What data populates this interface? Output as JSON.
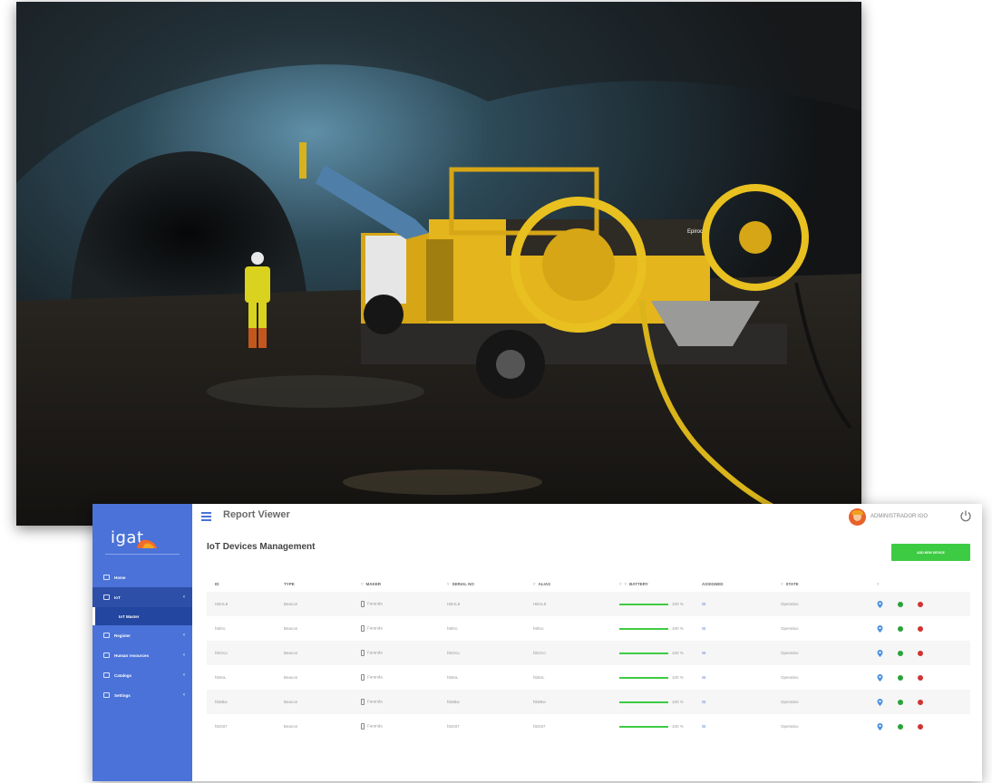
{
  "photo": {
    "alt_icon": "mine-photo",
    "brand_badge": "Epiroc"
  },
  "sidebar": {
    "logo_text": "igat",
    "items": [
      {
        "label": "Home",
        "icon": "home-icon"
      },
      {
        "label": "IoT",
        "icon": "iot-icon"
      },
      {
        "label": "IoT Master",
        "icon": ""
      },
      {
        "label": "Register",
        "icon": "register-icon"
      },
      {
        "label": "Human resources",
        "icon": "people-icon"
      },
      {
        "label": "Catalogs",
        "icon": "catalog-icon"
      },
      {
        "label": "Settings",
        "icon": "gear-icon"
      }
    ]
  },
  "header": {
    "title": "Report Viewer",
    "subtitle": "",
    "user": "ADMINISTRADOR IGO",
    "logout_icon": "power-icon"
  },
  "page": {
    "title": "IoT Devices Management",
    "add_button": "ADD NEW DEVICE"
  },
  "table": {
    "columns": [
      "ID",
      "TYPE",
      "MAKER",
      "SERIAL NO",
      "ALIAS",
      "BATTERY",
      "ASSIGNED",
      "STATE"
    ],
    "rows": [
      {
        "id": "HBAL8",
        "type": "Beacon",
        "maker": "Faranda",
        "serial": "HBAL8",
        "alias": "HBAL8",
        "battery": 100,
        "battery_label": "100 %",
        "assigned": "SI",
        "state": "Operativo"
      },
      {
        "id": "h6hro",
        "type": "Beacon",
        "maker": "Faranda",
        "serial": "h6hro",
        "alias": "h6hro",
        "battery": 100,
        "battery_label": "100 %",
        "assigned": "SI",
        "state": "Operativo"
      },
      {
        "id": "hbCKo",
        "type": "Beacon",
        "maker": "Faranda",
        "serial": "hbCKo",
        "alias": "hbCKo",
        "battery": 100,
        "battery_label": "100 %",
        "assigned": "SI",
        "state": "Operativo"
      },
      {
        "id": "hb6nL",
        "type": "Beacon",
        "maker": "Faranda",
        "serial": "hb6nL",
        "alias": "hb6nL",
        "battery": 100,
        "battery_label": "100 %",
        "assigned": "SI",
        "state": "Operativo"
      },
      {
        "id": "hb6Bw",
        "type": "Beacon",
        "maker": "Faranda",
        "serial": "hb6Bw",
        "alias": "hb6Bw",
        "battery": 100,
        "battery_label": "100 %",
        "assigned": "SI",
        "state": "Operativo"
      },
      {
        "id": "hbG87",
        "type": "Beacon",
        "maker": "Faranda",
        "serial": "hbG87",
        "alias": "hbG87",
        "battery": 100,
        "battery_label": "100 %",
        "assigned": "SI",
        "state": "Operativo"
      }
    ]
  },
  "colors": {
    "sidebar": "#4a72d8",
    "sidebar_active": "#2d4fa8",
    "add_button": "#3ecb44",
    "battery": "#3ecb44",
    "action_green": "#2aa33a",
    "action_red": "#d23333",
    "action_pin": "#4a8fe0"
  }
}
